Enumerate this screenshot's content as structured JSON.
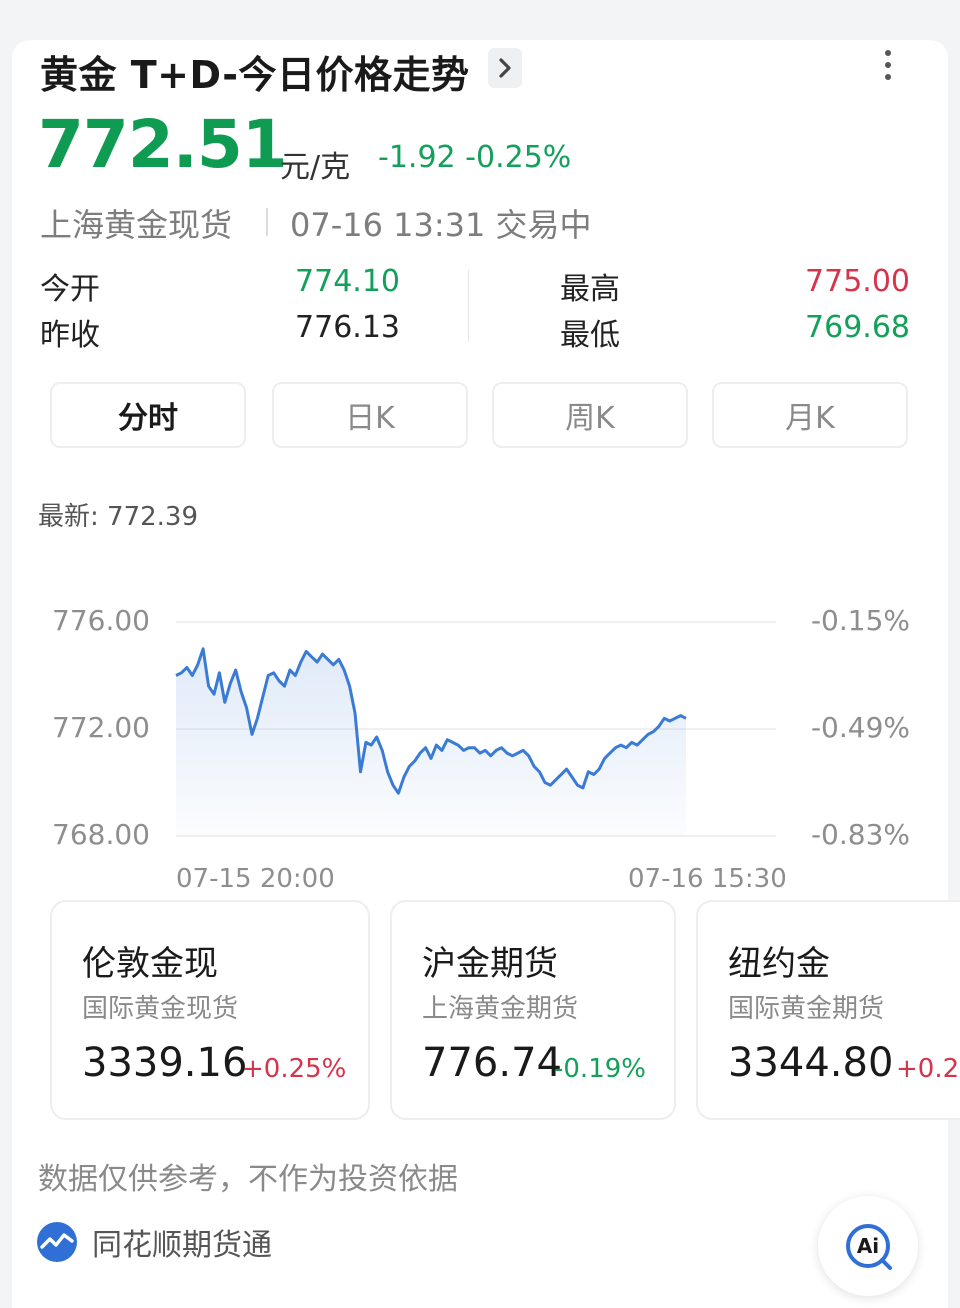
{
  "header": {
    "title": "黄金 T+D-今日价格走势",
    "price": "772.51",
    "unit": "元/克",
    "change": "-1.92 -0.25%",
    "market": "上海黄金现货",
    "datetime_status": "07-16 13:31 交易中"
  },
  "stats": {
    "open_label": "今开",
    "open_value": "774.10",
    "prev_close_label": "昨收",
    "prev_close_value": "776.13",
    "high_label": "最高",
    "high_value": "775.00",
    "low_label": "最低",
    "low_value": "769.68"
  },
  "tabs": [
    "分时",
    "日K",
    "周K",
    "月K"
  ],
  "chart": {
    "latest_label": "最新: 772.39"
  },
  "chart_data": {
    "type": "line",
    "ylim": [
      768.0,
      776.0
    ],
    "y_ticks": [
      "776.00",
      "772.00",
      "768.00"
    ],
    "y2_ticks": [
      "-0.15%",
      "-0.49%",
      "-0.83%"
    ],
    "x_tick_labels": [
      "07-15 20:00",
      "07-16 15:30"
    ],
    "grid": true,
    "series": [
      {
        "values": [
          774.0,
          774.1,
          774.3,
          774.0,
          774.4,
          775.0,
          773.6,
          773.3,
          774.1,
          773.0,
          773.7,
          774.2,
          773.4,
          772.8,
          771.8,
          772.4,
          773.2,
          774.0,
          774.1,
          773.8,
          773.6,
          774.2,
          774.0,
          774.5,
          774.9,
          774.7,
          774.5,
          774.8,
          774.6,
          774.4,
          774.6,
          774.2,
          773.6,
          772.6,
          770.4,
          771.5,
          771.4,
          771.7,
          771.2,
          770.4,
          769.9,
          769.6,
          770.2,
          770.6,
          770.8,
          771.1,
          771.3,
          770.9,
          771.4,
          771.2,
          771.6,
          771.5,
          771.4,
          771.2,
          771.3,
          771.3,
          771.1,
          771.2,
          771.0,
          771.2,
          771.3,
          771.1,
          771.0,
          771.1,
          771.2,
          771.0,
          770.6,
          770.4,
          770.0,
          769.9,
          770.1,
          770.3,
          770.5,
          770.2,
          769.9,
          769.8,
          770.4,
          770.3,
          770.5,
          770.9,
          771.1,
          771.3,
          771.4,
          771.3,
          771.5,
          771.4,
          771.6,
          771.8,
          771.9,
          772.1,
          772.4,
          772.3,
          772.4,
          772.5,
          772.4
        ]
      }
    ]
  },
  "markets": [
    {
      "name": "伦敦金现",
      "sub": "国际黄金现货",
      "price": "3339.16",
      "change": "+0.25%",
      "dir": "up"
    },
    {
      "name": "沪金期货",
      "sub": "上海黄金期货",
      "price": "776.74",
      "change": "-0.19%",
      "dir": "down"
    },
    {
      "name": "纽约金",
      "sub": "国际黄金期货",
      "price": "3344.80",
      "change": "+0.2",
      "dir": "up"
    }
  ],
  "footer": {
    "disclaimer": "数据仅供参考，不作为投资依据",
    "brand": "同花顺期货通",
    "ai_label": "Ai"
  },
  "colors": {
    "price_green": "#0f9b52",
    "down_green": "#13a05a",
    "up_red": "#d5344b",
    "line_blue": "#3a7bd5"
  }
}
